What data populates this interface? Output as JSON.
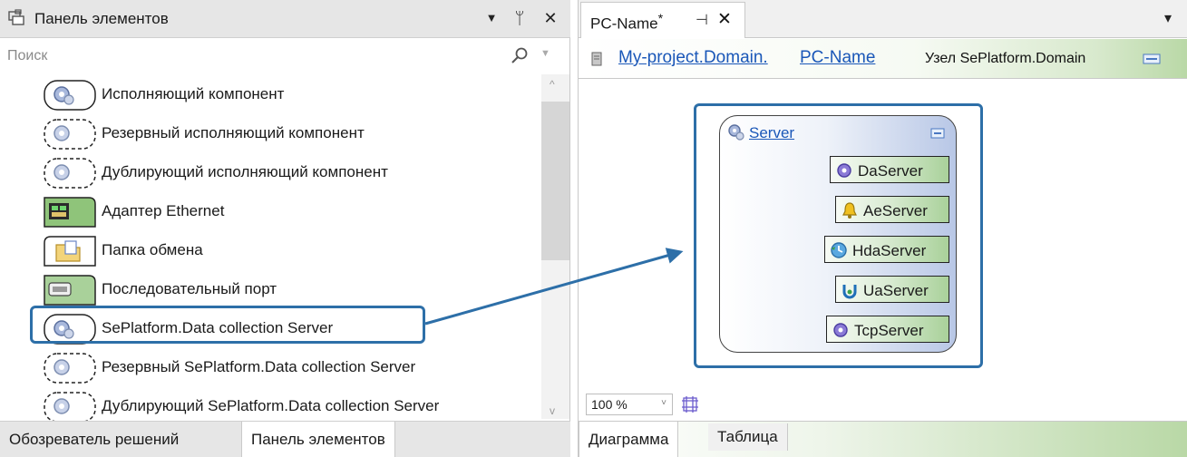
{
  "left_panel": {
    "title": "Панель элементов",
    "dropdown_glyph": "▼",
    "pin_glyph": "ᛘ",
    "close_glyph": "✕",
    "search": {
      "placeholder": "Поиск"
    },
    "items": [
      {
        "label": "Исполняющий компонент",
        "icon": "gear-component-icon"
      },
      {
        "label": "Резервный исполняющий компонент",
        "icon": "gear-component-dashed-icon"
      },
      {
        "label": "Дублирующий исполняющий компонент",
        "icon": "gear-component-dashed-icon"
      },
      {
        "label": "Адаптер Ethernet",
        "icon": "ethernet-adapter-icon"
      },
      {
        "label": "Папка обмена",
        "icon": "exchange-folder-icon"
      },
      {
        "label": "Последовательный порт",
        "icon": "serial-port-icon"
      },
      {
        "label": "SePlatform.Data collection Server",
        "icon": "gear-component-icon"
      },
      {
        "label": "Резервный SePlatform.Data collection Server",
        "icon": "gear-component-dashed-icon"
      },
      {
        "label": "Дублирующий SePlatform.Data collection Server",
        "icon": "gear-component-dashed-icon"
      }
    ],
    "tabs": [
      {
        "label": "Обозреватель решений"
      },
      {
        "label": "Панель элементов"
      }
    ]
  },
  "right_panel": {
    "doc_tab": {
      "name": "PC-Name",
      "modified_mark": "*",
      "pin_glyph": "⊣",
      "close_glyph": "✕"
    },
    "overflow_glyph": "▾",
    "breadcrumb": {
      "project_link": "My-project.Domain.",
      "node_link": "PC-Name",
      "node_type": "Узел SePlatform.Domain"
    },
    "diagram": {
      "server_label": "Server",
      "ports": [
        {
          "label": "DaServer",
          "icon": "gear-purple-icon"
        },
        {
          "label": "AeServer",
          "icon": "bell-icon"
        },
        {
          "label": "HdaServer",
          "icon": "history-clock-icon"
        },
        {
          "label": "UaServer",
          "icon": "ua-icon"
        },
        {
          "label": "TcpServer",
          "icon": "gear-purple-icon"
        }
      ]
    },
    "zoom": {
      "value": "100 %",
      "arrow": "˅"
    },
    "tabs": [
      {
        "label": "Диаграмма"
      },
      {
        "label": "Таблица"
      }
    ]
  },
  "colors": {
    "highlight_border": "#2d6fa8",
    "link": "#1a57b8",
    "port_green": "#a9d19a",
    "header_bg": "#e6e6e6"
  }
}
